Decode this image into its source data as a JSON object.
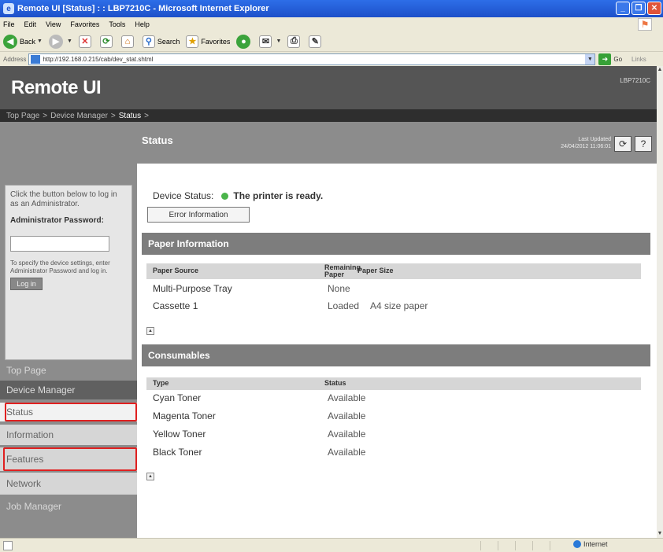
{
  "window": {
    "title": "Remote UI [Status] : : LBP7210C - Microsoft Internet Explorer",
    "ie_logo": "e"
  },
  "menubar": {
    "items": [
      "File",
      "Edit",
      "View",
      "Favorites",
      "Tools",
      "Help"
    ]
  },
  "toolbar": {
    "back_label": "Back",
    "search_label": "Search",
    "favorites_label": "Favorites"
  },
  "addressbar": {
    "label": "Address",
    "url": "http://192.168.0.215/cab/dev_stat.shtml",
    "go_label": "Go",
    "links_label": "Links"
  },
  "remoteui": {
    "logo": "Remote UI",
    "model": "LBP7210C"
  },
  "breadcrumb": {
    "top": "Top Page",
    "device": "Device Manager",
    "current": "Status",
    "sep": ">"
  },
  "login": {
    "hint": "Click the button below to log in as an Administrator.",
    "admin_label": "Administrator Password:",
    "hint2": "To specify the device settings, enter Administrator Password and log in.",
    "login_button": "Log in"
  },
  "nav": {
    "top_page": "Top Page",
    "device_manager": "Device Manager",
    "status": "Status",
    "information": "Information",
    "features": "Features",
    "network": "Network",
    "job_manager": "Job Manager"
  },
  "header": {
    "title": "Status",
    "last_updated_label": "Last Updated",
    "last_updated_value": "24/04/2012 11:06:01",
    "refresh_icon": "⟳",
    "help_icon": "?"
  },
  "device_status": {
    "label": "Device Status:",
    "message": "The printer is ready.",
    "status_color": "#4ab44a",
    "error_button": "Error Information"
  },
  "paper": {
    "title": "Paper Information",
    "columns": [
      "Paper Source",
      "Remaining Paper",
      "Paper Size"
    ],
    "rows": [
      {
        "source": "Multi-Purpose Tray",
        "remaining": "None",
        "size": ""
      },
      {
        "source": "Cassette 1",
        "remaining": "Loaded",
        "size": "A4 size paper"
      }
    ]
  },
  "consumables": {
    "title": "Consumables",
    "columns": [
      "Type",
      "Status"
    ],
    "rows": [
      {
        "type": "Cyan Toner",
        "status": "Available"
      },
      {
        "type": "Magenta Toner",
        "status": "Available"
      },
      {
        "type": "Yellow Toner",
        "status": "Available"
      },
      {
        "type": "Black Toner",
        "status": "Available"
      }
    ]
  },
  "statusbar": {
    "zone": "Internet"
  },
  "colors": {
    "highlight_border": "#e02020",
    "status_ready": "#4ab44a"
  }
}
